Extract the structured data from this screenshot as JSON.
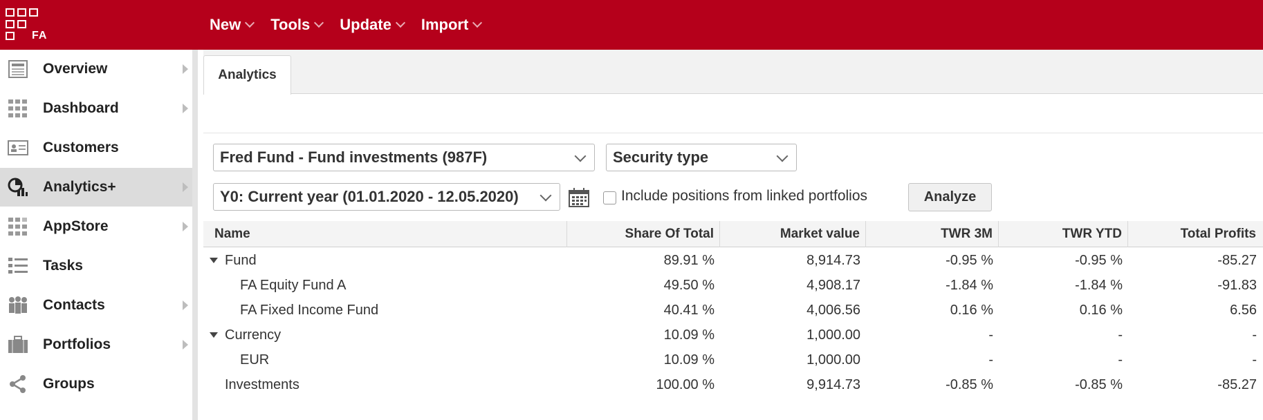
{
  "app": {
    "logo_text": "FA",
    "brand_color": "#b5001b"
  },
  "topmenu": [
    {
      "label": "New"
    },
    {
      "label": "Tools"
    },
    {
      "label": "Update"
    },
    {
      "label": "Import"
    }
  ],
  "sidebar": {
    "items": [
      {
        "label": "Overview",
        "icon": "overview-icon",
        "has_arrow": true
      },
      {
        "label": "Dashboard",
        "icon": "dashboard-icon",
        "has_arrow": true
      },
      {
        "label": "Customers",
        "icon": "customers-icon",
        "has_arrow": false
      },
      {
        "label": "Analytics+",
        "icon": "analytics-icon",
        "has_arrow": true,
        "active": true
      },
      {
        "label": "AppStore",
        "icon": "appstore-icon",
        "has_arrow": true
      },
      {
        "label": "Tasks",
        "icon": "tasks-icon",
        "has_arrow": false
      },
      {
        "label": "Contacts",
        "icon": "contacts-icon",
        "has_arrow": true
      },
      {
        "label": "Portfolios",
        "icon": "portfolios-icon",
        "has_arrow": true
      },
      {
        "label": "Groups",
        "icon": "groups-icon",
        "has_arrow": false
      }
    ]
  },
  "tabs": [
    {
      "label": "Analytics",
      "active": true
    }
  ],
  "filters": {
    "portfolio": "Fred Fund - Fund investments (987F)",
    "grouping": "Security type",
    "period": "Y0: Current year (01.01.2020 - 12.05.2020)",
    "include_linked_label": "Include positions from linked portfolios",
    "include_linked_checked": false,
    "analyze_label": "Analyze"
  },
  "table": {
    "columns": [
      "Name",
      "Share Of Total",
      "Market value",
      "TWR 3M",
      "TWR YTD",
      "Total Profits"
    ],
    "rows": [
      {
        "name": "Fund",
        "level": 0,
        "expandable": true,
        "share": "89.91 %",
        "market_value": "8,914.73",
        "twr_3m": "-0.95 %",
        "twr_ytd": "-0.95 %",
        "total_profits": "-85.27"
      },
      {
        "name": "FA Equity Fund A",
        "level": 1,
        "expandable": false,
        "share": "49.50 %",
        "market_value": "4,908.17",
        "twr_3m": "-1.84 %",
        "twr_ytd": "-1.84 %",
        "total_profits": "-91.83"
      },
      {
        "name": "FA Fixed Income Fund",
        "level": 1,
        "expandable": false,
        "share": "40.41 %",
        "market_value": "4,006.56",
        "twr_3m": "0.16 %",
        "twr_ytd": "0.16 %",
        "total_profits": "6.56"
      },
      {
        "name": "Currency",
        "level": 0,
        "expandable": true,
        "share": "10.09 %",
        "market_value": "1,000.00",
        "twr_3m": "-",
        "twr_ytd": "-",
        "total_profits": "-"
      },
      {
        "name": "EUR",
        "level": 1,
        "expandable": false,
        "share": "10.09 %",
        "market_value": "1,000.00",
        "twr_3m": "-",
        "twr_ytd": "-",
        "total_profits": "-"
      },
      {
        "name": "Investments",
        "level": 0,
        "expandable": false,
        "share": "100.00 %",
        "market_value": "9,914.73",
        "twr_3m": "-0.85 %",
        "twr_ytd": "-0.85 %",
        "total_profits": "-85.27"
      }
    ]
  }
}
